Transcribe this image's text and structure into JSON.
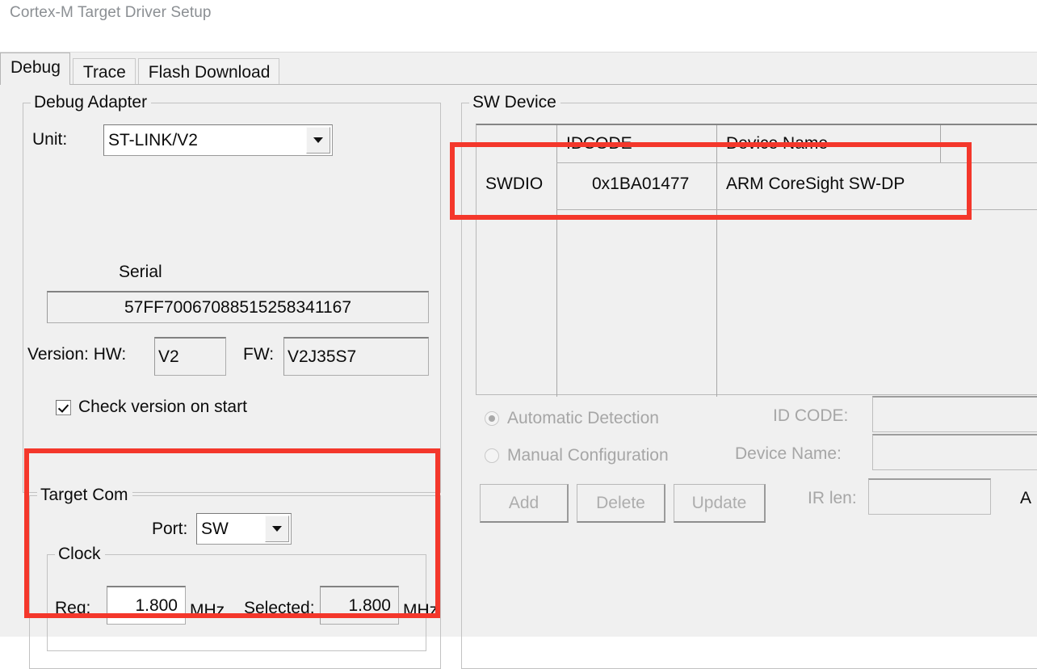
{
  "window": {
    "title": "Cortex-M Target Driver Setup"
  },
  "tabs": [
    {
      "label": "Debug",
      "active": true
    },
    {
      "label": "Trace",
      "active": false
    },
    {
      "label": "Flash Download",
      "active": false
    }
  ],
  "debug_adapter": {
    "group_label": "Debug Adapter",
    "unit_label": "Unit:",
    "unit_value": "ST-LINK/V2",
    "serial_label": "Serial",
    "serial_value": "57FF70067088515258341167",
    "version_label": "Version: HW:",
    "hw_value": "V2",
    "fw_label": "FW:",
    "fw_value": "V2J35S7",
    "check_version_label": "Check version on start",
    "check_version_checked": true
  },
  "target_com": {
    "group_label": "Target Com",
    "port_label": "Port:",
    "port_value": "SW",
    "clock": {
      "group_label": "Clock",
      "req_label": "Req:",
      "req_value": "1.800",
      "req_unit": "MHz",
      "selected_label": "Selected:",
      "selected_value": "1.800",
      "selected_unit": "MHz"
    }
  },
  "sw_device": {
    "group_label": "SW Device",
    "table": {
      "row_header": "SWDIO",
      "columns": [
        "IDCODE",
        "Device Name",
        ""
      ],
      "rows": [
        {
          "idcode": "0x1BA01477",
          "device_name": "ARM CoreSight SW-DP",
          "extra": ""
        }
      ]
    },
    "detection": {
      "automatic_label": "Automatic Detection",
      "automatic_selected": true,
      "manual_label": "Manual Configuration",
      "manual_selected": false,
      "id_code_label": "ID CODE:",
      "id_code_value": "",
      "device_name_label": "Device Name:",
      "device_name_value": "",
      "ir_len_label": "IR len:",
      "ir_len_value": "",
      "ap_label_clipped": "A"
    },
    "buttons": [
      {
        "label": "Add",
        "enabled": false
      },
      {
        "label": "Delete",
        "enabled": false
      },
      {
        "label": "Update",
        "enabled": false
      }
    ]
  },
  "annotations": {
    "highlight_color": "#f4372b",
    "boxes": [
      {
        "name": "sw-device-table-highlight"
      },
      {
        "name": "target-com-highlight"
      }
    ]
  }
}
